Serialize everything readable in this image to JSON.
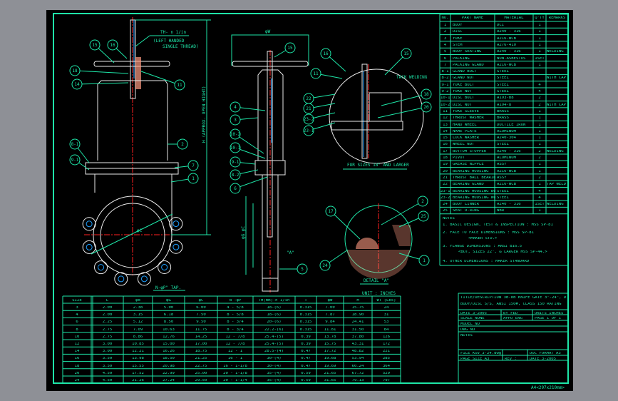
{
  "sheet_format": "A4<297x210mm>",
  "colors": {
    "line": "#1ee6a8",
    "outline": "#e8e8e8",
    "centerline": "#ff2020",
    "stem": "#20a0ff",
    "hatch": "#ff9a80",
    "background": "#000000"
  },
  "drawing": {
    "thread_note": [
      "TH- n 1/in",
      "(LEFT HANDED",
      "SINGLE THREAD)"
    ],
    "height_label": "H (APPROX. OPEN HIGHT)",
    "tap_label": "N-φP\" TAP.",
    "phi_c": "φC",
    "phi_w": "φW",
    "phi_g_c": "φG φC",
    "detail_mark": "\"A\"",
    "large_size_caption": "FOR SIZES 18\" AND LARGER",
    "tack_welding": "TACK WELDING",
    "detail_caption": "DETAIL \"A\"",
    "unit": "UNIT : INCHES",
    "balloons": [
      "15",
      "16",
      "18",
      "14",
      "11",
      "2",
      "8-1",
      "9-1",
      "7",
      "1",
      "15",
      "4",
      "3",
      "10-2",
      "10-1",
      "9-1",
      "8-2",
      "6",
      "5",
      "11",
      "22",
      "21",
      "23-2",
      "23-1",
      "16",
      "15",
      "18",
      "20",
      "17",
      "2",
      "25",
      "24",
      "1"
    ]
  },
  "parts_list": {
    "headers": [
      "NO.",
      "PART NAME",
      "MATERIAL",
      "Q'TY",
      "REMARKS"
    ],
    "rows": [
      [
        "1",
        "BODY",
        "DCI",
        "1",
        ""
      ],
      [
        "2",
        "DISC",
        "A240 - 316",
        "1",
        ""
      ],
      [
        "3",
        "YOKE",
        "A216-WCB",
        "1",
        ""
      ],
      [
        "4",
        "STEM",
        "A276-410",
        "1",
        ""
      ],
      [
        "5",
        "BODY SEATING",
        "A240 - 316",
        "1",
        "WELDING"
      ],
      [
        "6",
        "PACKING",
        "NON-ASBESTOS",
        "1SET",
        ""
      ],
      [
        "7",
        "PACKING GLAND",
        "A216-WCB",
        "1",
        ""
      ],
      [
        "8-1",
        "GLAND BOLT",
        "STEEL",
        "",
        ""
      ],
      [
        "8-2",
        "GLAND NUT",
        "STEEL",
        "",
        "WITH CAP NUT"
      ],
      [
        "9-1",
        "YOKE BOLT",
        "STEEL",
        "4",
        ""
      ],
      [
        "9-2",
        "YOKE NUT",
        "STEEL",
        "4",
        ""
      ],
      [
        "10-1",
        "DISC BOLT",
        "A193-B8",
        "2",
        ""
      ],
      [
        "10-2",
        "DISC NUT",
        "A194-8",
        "2",
        "WITH CAP NUT"
      ],
      [
        "11",
        "YOKE SLEEVE",
        "BRASS",
        "1",
        ""
      ],
      [
        "12",
        "THRUST WASHER",
        "BRASS",
        "1",
        ""
      ],
      [
        "13",
        "HAND WHEEL",
        "DUCTILE IRON",
        "1",
        ""
      ],
      [
        "14",
        "NAME PLATE",
        "ALUMINUM",
        "1",
        ""
      ],
      [
        "15",
        "LOCK WASHER",
        "A240-304",
        "1",
        ""
      ],
      [
        "16",
        "WHEEL NUT",
        "STEEL",
        "1",
        ""
      ],
      [
        "17",
        "BOTTOM STOPPER",
        "A240 - 316",
        "2",
        "WELDING"
      ],
      [
        "18",
        "PIVOT",
        "ALUMINUM",
        "2",
        ""
      ],
      [
        "19",
        "GREASE NIPPLE",
        "ASSY",
        "1",
        ""
      ],
      [
        "20",
        "BEARING HOUSING",
        "A216-WCB",
        "1",
        ""
      ],
      [
        "21",
        "THRUST BALL BEARING",
        "ASSY",
        "2",
        ""
      ],
      [
        "22",
        "BEARING GLAND",
        "A216-WCB",
        "1",
        "TAP WELD"
      ],
      [
        "23-1",
        "BEARING HOUSING BOLT",
        "STEEL",
        "4",
        ""
      ],
      [
        "23-2",
        "BEARING HOUSING NUT",
        "STEEL",
        "4",
        ""
      ],
      [
        "24",
        "BODY LINNER",
        "A240 - 316",
        "1SET",
        "WELDING"
      ],
      [
        "25",
        "SEAT O-RING",
        "NBR",
        "1",
        ""
      ]
    ]
  },
  "notes": {
    "title": "NOTES",
    "lines": [
      "1. BASIC DESIGN, TEST & INSPECTION : MSS SP-81",
      "2. FACE TO FACE DIMENSIONS : MSS SP-81",
      "<MAKER STD.>",
      "3. FLANGE DIMENSIONS : ANSI B16.5",
      "<BUT, SIZES 22\", & LARGER MSS SP-44.>",
      "4. OTHER DIMENSIONS : MAKER STANDARD"
    ]
  },
  "dimension_table": {
    "headers": [
      "SIZE",
      "L",
      "φd",
      "φG",
      "φC",
      "N -φP",
      "TH(mm)-n 1/in",
      "T",
      "φW",
      "H",
      "WT (Lbs)"
    ],
    "rows": [
      [
        "3",
        "2.00",
        "2.38",
        "5.00",
        "6.00",
        "4 - 5/8",
        "18-(6)",
        "0.315",
        "7.00",
        "15.75",
        "24"
      ],
      [
        "4",
        "2.00",
        "3.15",
        "6.18",
        "7.50",
        "8 - 5/8",
        "18-(6)",
        "0.315",
        "7.87",
        "18.90",
        "31"
      ],
      [
        "6",
        "2.25",
        "5.12",
        "8.50",
        "9.50",
        "8 - 3/4",
        "20-(6)",
        "0.315",
        "9.84",
        "24.41",
        "53"
      ],
      [
        "8",
        "2.75",
        "7.09",
        "10.63",
        "11.75",
        "8 - 3/4",
        "22.2-(6)",
        "0.315",
        "11.81",
        "31.50",
        "84"
      ],
      [
        "10",
        "2.75",
        "8.86",
        "12.76",
        "14.25",
        "12 - 7/8",
        "25.4-(5)",
        "0.39",
        "13.78",
        "37.80",
        "126"
      ],
      [
        "12",
        "3.00",
        "10.85",
        "15.00",
        "17.00",
        "12 - 7/8",
        "25.4-(5)",
        "0.39",
        "15.75",
        "43.31",
        "172"
      ],
      [
        "14",
        "3.00",
        "12.21",
        "16.26",
        "18.75",
        "12 - 1",
        "28.5-(4)",
        "0.47",
        "17.72",
        "48.82",
        "221"
      ],
      [
        "16",
        "3.50",
        "13.98",
        "18.50",
        "21.25",
        "16 - 1",
        "30-(4)",
        "0.47",
        "19.68",
        "53.94",
        "285"
      ],
      [
        "18",
        "3.50",
        "15.55",
        "20.98",
        "22.75",
        "16 - 1-1/8",
        "30-(4)",
        "0.47",
        "19.69",
        "60.24",
        "364"
      ],
      [
        "20",
        "4.50",
        "17.52",
        "22.99",
        "25.00",
        "20 - 1-1/8",
        "35-(4)",
        "0.59",
        "21.65",
        "67.72",
        "529"
      ],
      [
        "24",
        "4.50",
        "21.26",
        "27.24",
        "29.50",
        "20 - 1-1/4",
        "35-(4)",
        "0.59",
        "31.65",
        "79.13",
        "797"
      ]
    ]
  },
  "title_block": {
    "description": [
      "TITLE/DESCRIPTION 3B-8B KNIFE GATE 3\"-24\", DCI",
      "BODY/DISC S/S, ANSI 150#, CLASS 150 RATING"
    ],
    "date": "DATE 3-2005",
    "by": "BY FED",
    "units": "UNITS INCHES",
    "scale": "SCALE NONE",
    "appd": "APPD ENG",
    "page": "PAGE 1 OF 1",
    "model": "MODEL NO",
    "dwg": "DWG NO",
    "notes": "NOTES",
    "file": "FILE KGV_3-24.dwg",
    "doc_format": "DOC FORMAT A3",
    "page_size": "PAGE SIZE A3",
    "rev": "REV :",
    "rev_date": "DATE 3-2005"
  }
}
